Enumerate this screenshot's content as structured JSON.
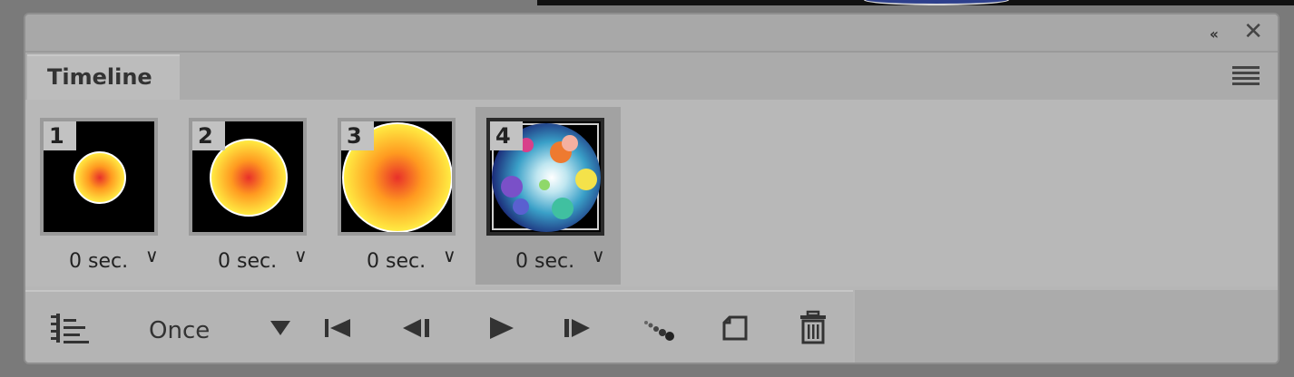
{
  "panel": {
    "collapse_label": "‹‹",
    "close_label": "✕"
  },
  "tabs": [
    {
      "label": "Timeline"
    }
  ],
  "frames": [
    {
      "number": "1",
      "delay": "0 sec.",
      "chevron": "∨"
    },
    {
      "number": "2",
      "delay": "0 sec.",
      "chevron": "∨"
    },
    {
      "number": "3",
      "delay": "0 sec.",
      "chevron": "∨"
    },
    {
      "number": "4",
      "delay": "0 sec.",
      "chevron": "∨"
    }
  ],
  "toolbar": {
    "loop_value": "Once"
  },
  "colors": {
    "panel_bg": "#b6b6b6",
    "selected_frame_bg": "#a2a2a2",
    "icon_color": "#333333"
  },
  "icons": {
    "collapse": "double-chevron-left-icon",
    "close": "close-icon",
    "panel_menu": "hamburger-menu-icon",
    "convert_timeline": "convert-to-video-timeline-icon",
    "first_frame": "select-first-frame-icon",
    "prev_frame": "select-previous-frame-icon",
    "play": "play-icon",
    "next_frame": "select-next-frame-icon",
    "tween": "tween-frames-icon",
    "duplicate": "duplicate-frame-icon",
    "delete": "trash-icon"
  }
}
